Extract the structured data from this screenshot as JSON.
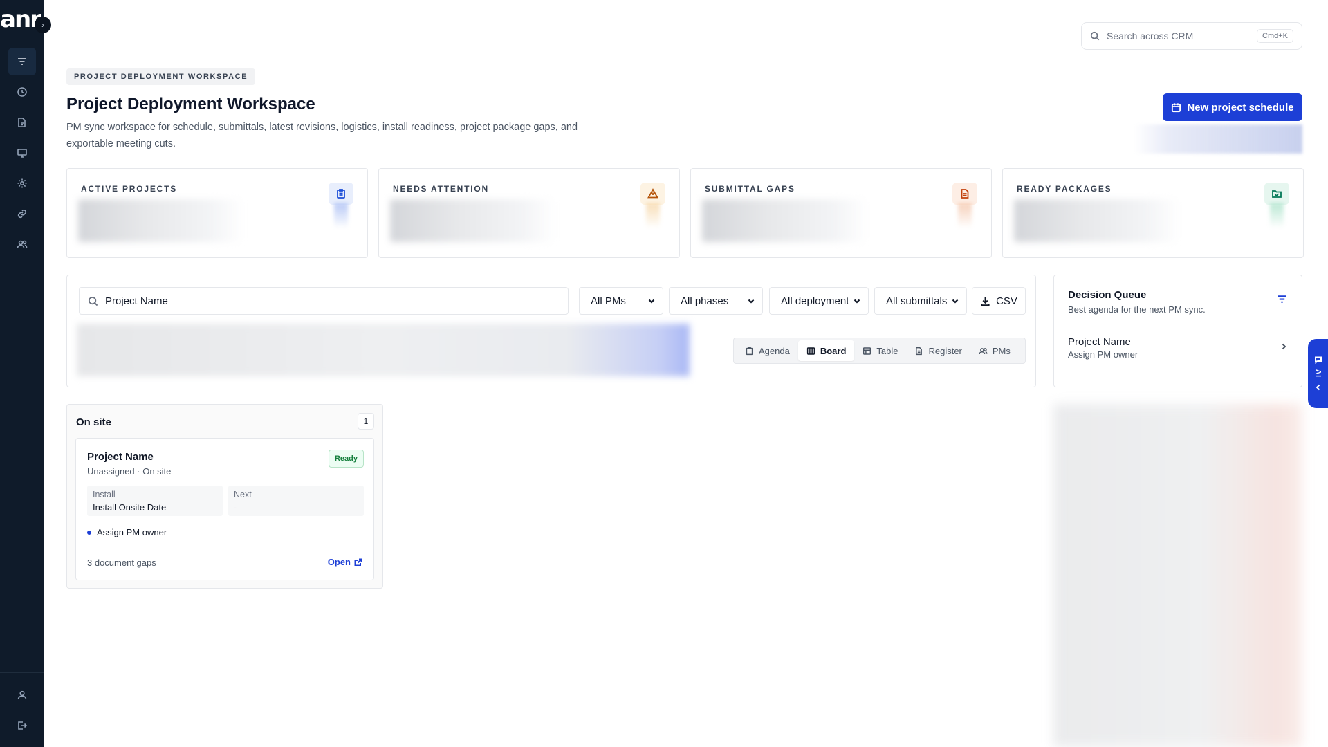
{
  "app": {
    "logo": "anr"
  },
  "sidebar": {
    "items": [
      {
        "name": "filter-icon"
      },
      {
        "name": "clock-icon"
      },
      {
        "name": "documents-icon"
      },
      {
        "name": "monitor-icon"
      },
      {
        "name": "gear-icon"
      },
      {
        "name": "link-icon"
      },
      {
        "name": "users-icon"
      }
    ],
    "bottom": [
      {
        "name": "user-icon"
      },
      {
        "name": "logout-icon"
      }
    ]
  },
  "search": {
    "placeholder": "Search across CRM",
    "shortcut": "Cmd+K"
  },
  "header": {
    "eyebrow": "PROJECT DEPLOYMENT WORKSPACE",
    "title": "Project Deployment Workspace",
    "description": "PM sync workspace for schedule, submittals, latest revisions, logistics, install readiness, project package gaps, and exportable meeting cuts.",
    "primary_button": "New project schedule"
  },
  "kpis": [
    {
      "label": "ACTIVE PROJECTS",
      "icon": "clipboard-icon",
      "color": "#1d4ed8",
      "bg": "#e8eefc"
    },
    {
      "label": "NEEDS ATTENTION",
      "icon": "warning-icon",
      "color": "#b45309",
      "bg": "#fdf3e3"
    },
    {
      "label": "SUBMITTAL GAPS",
      "icon": "document-icon",
      "color": "#c2410c",
      "bg": "#fdeee5"
    },
    {
      "label": "READY PACKAGES",
      "icon": "folder-check-icon",
      "color": "#047857",
      "bg": "#e6f6ef"
    }
  ],
  "filters": {
    "search_value": "Project Name",
    "pm": "All PMs",
    "phase": "All phases",
    "deployment": "All deployment",
    "submittals": "All submittals",
    "csv": "CSV"
  },
  "views": [
    {
      "label": "Agenda",
      "icon": "clipboard-icon"
    },
    {
      "label": "Board",
      "icon": "columns-icon",
      "active": true
    },
    {
      "label": "Table",
      "icon": "table-icon"
    },
    {
      "label": "Register",
      "icon": "document-icon"
    },
    {
      "label": "PMs",
      "icon": "users-icon"
    }
  ],
  "decision_queue": {
    "title": "Decision Queue",
    "subtitle": "Best agenda for the next PM sync.",
    "item": {
      "title": "Project Name",
      "subtitle": "Assign PM owner"
    }
  },
  "ai_tab": {
    "label": "AI"
  },
  "board": {
    "column": {
      "title": "On site",
      "count": "1"
    },
    "card": {
      "title": "Project Name",
      "subtitle": "Unassigned · On site",
      "badge": "Ready",
      "install_label": "Install",
      "install_value": "Install Onsite Date",
      "next_label": "Next",
      "next_value": "-",
      "action": "Assign PM owner",
      "gaps": "3 document gaps",
      "open": "Open"
    }
  }
}
